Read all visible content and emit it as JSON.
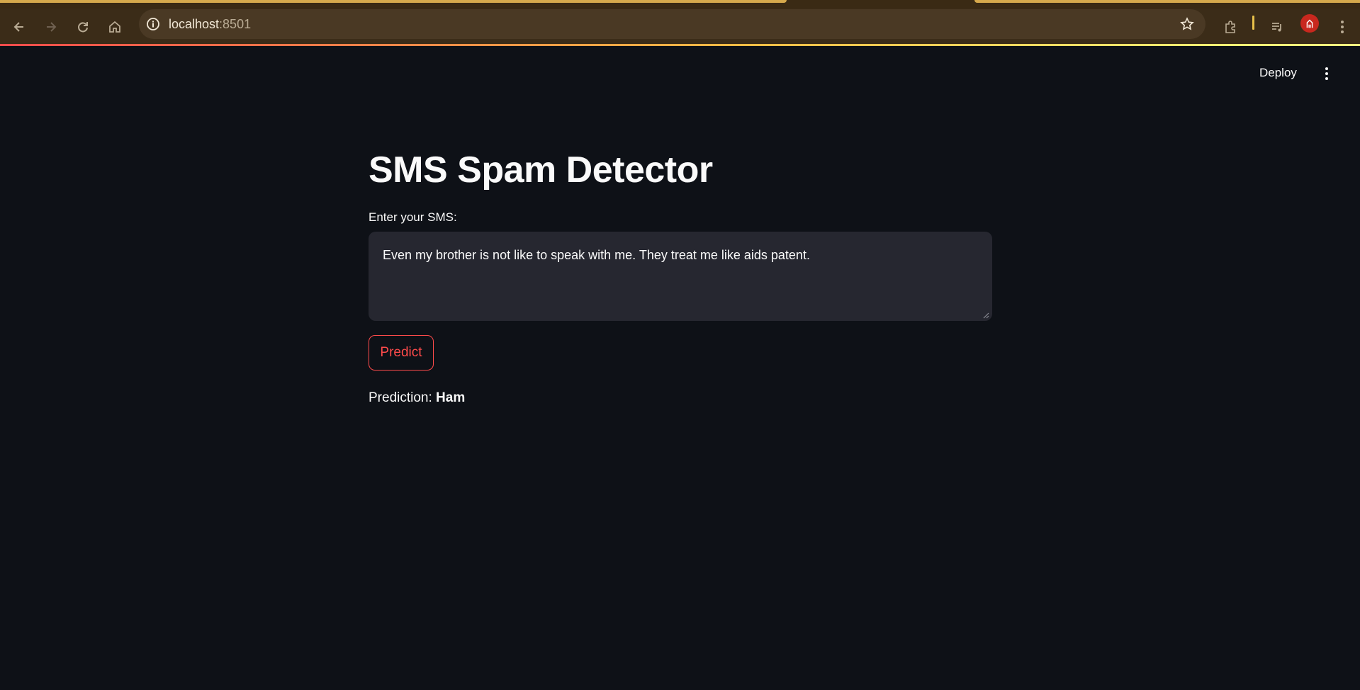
{
  "browser": {
    "url_host": "localhost",
    "url_port": ":8501"
  },
  "header": {
    "deploy_label": "Deploy"
  },
  "main": {
    "title": "SMS Spam Detector",
    "input_label": "Enter your SMS:",
    "input_value": "Even my brother is not like to speak with me. They treat me like aids patent.",
    "predict_label": "Predict",
    "prediction_prefix": "Prediction: ",
    "prediction_value": "Ham"
  },
  "colors": {
    "background": "#0e1117",
    "accent": "#ff4b4b",
    "input_bg": "#262730"
  }
}
